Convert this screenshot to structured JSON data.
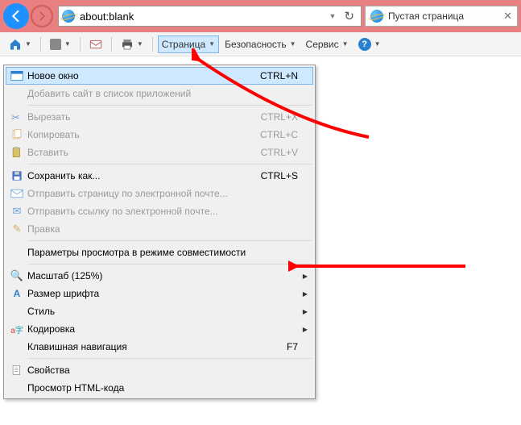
{
  "nav": {
    "url": "about:blank",
    "tab_title": "Пустая страница"
  },
  "cmdbar": {
    "page": "Страница",
    "safety": "Безопасность",
    "service": "Сервис"
  },
  "menu": {
    "new_window": {
      "label": "Новое окно",
      "shortcut": "CTRL+N"
    },
    "add_site": {
      "label": "Добавить сайт в список приложений"
    },
    "cut": {
      "label": "Вырезать",
      "shortcut": "CTRL+X"
    },
    "copy": {
      "label": "Копировать",
      "shortcut": "CTRL+C"
    },
    "paste": {
      "label": "Вставить",
      "shortcut": "CTRL+V"
    },
    "save_as": {
      "label": "Сохранить как...",
      "shortcut": "CTRL+S"
    },
    "email_page": {
      "label": "Отправить страницу по электронной почте..."
    },
    "email_link": {
      "label": "Отправить ссылку по электронной почте..."
    },
    "edit": {
      "label": "Правка"
    },
    "compat": {
      "label": "Параметры просмотра в режиме совместимости"
    },
    "zoom": {
      "label": "Масштаб (125%)"
    },
    "text_size": {
      "label": "Размер шрифта"
    },
    "style": {
      "label": "Стиль"
    },
    "encoding": {
      "label": "Кодировка"
    },
    "caret": {
      "label": "Клавишная навигация",
      "shortcut": "F7"
    },
    "properties": {
      "label": "Свойства"
    },
    "view_source": {
      "label": "Просмотр HTML-кода"
    }
  }
}
